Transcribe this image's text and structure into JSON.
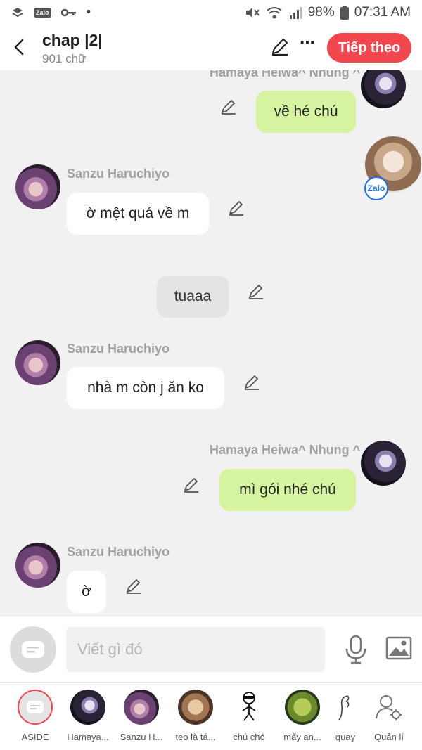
{
  "status_bar": {
    "left_icons": [
      "layers-icon",
      "zalo-icon",
      "key-icon",
      "dot-icon"
    ],
    "zalo_label": "Zalo",
    "dot": "•",
    "battery": "98%",
    "time": "07:31 AM"
  },
  "header": {
    "title": "chap |2|",
    "subtitle": "901 chữ",
    "more": "⋯",
    "next_label": "Tiếp theo"
  },
  "messages": [
    {
      "id": "m1",
      "sender": "Hamaya Heiwa^ Nhung ^",
      "text": "về hé chú",
      "side": "right"
    },
    {
      "id": "m2",
      "sender": "Sanzu Haruchiyo",
      "text": "ờ mệt quá về m",
      "side": "left"
    },
    {
      "id": "m3",
      "sender": "",
      "text": "tuaaa",
      "side": "center"
    },
    {
      "id": "m4",
      "sender": "Sanzu Haruchiyo",
      "text": "nhà m còn j ăn ko",
      "side": "left"
    },
    {
      "id": "m5",
      "sender": "Hamaya Heiwa^ Nhung ^",
      "text": "mì gói nhé chú",
      "side": "right"
    },
    {
      "id": "m6",
      "sender": "Sanzu Haruchiyo",
      "text": "ờ",
      "side": "left"
    }
  ],
  "zalo_badge": "Zalo",
  "composer": {
    "placeholder": "Viết gì đó"
  },
  "bottom_nav": [
    {
      "label": "ASIDE"
    },
    {
      "label": "Hamaya..."
    },
    {
      "label": "Sanzu H..."
    },
    {
      "label": "teo là tá..."
    },
    {
      "label": "chú chó"
    },
    {
      "label": "mấy an..."
    },
    {
      "label": "quay"
    },
    {
      "label": "Quản lí"
    }
  ],
  "colors": {
    "accent": "#f2464e",
    "bubble_right": "#d6f49f",
    "bubble_left": "#ffffff",
    "background": "#f1f1f1"
  }
}
